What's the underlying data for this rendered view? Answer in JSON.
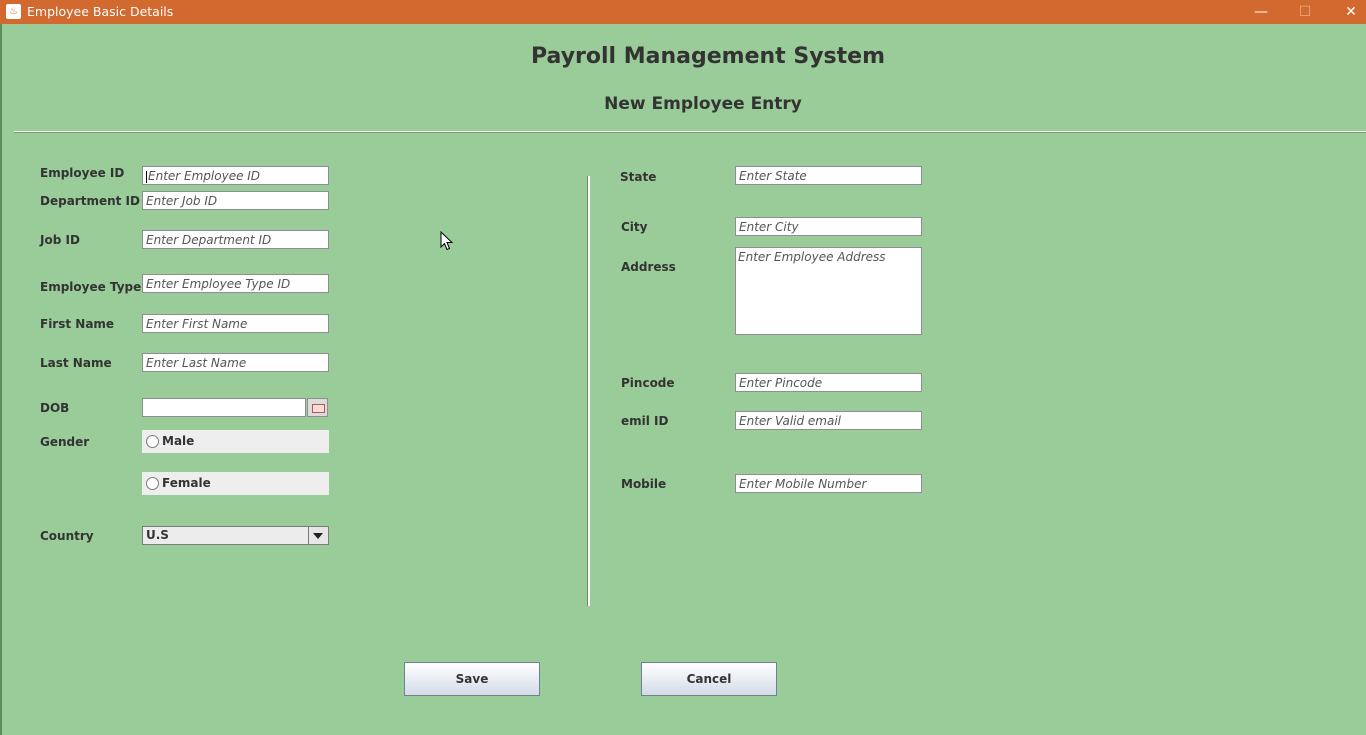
{
  "window": {
    "title": "Employee Basic Details",
    "controls": {
      "minimize": "—",
      "maximize": "☐",
      "close": "✕"
    }
  },
  "header": {
    "title": "Payroll Management System",
    "subtitle": "New Employee Entry"
  },
  "left_form": {
    "employee_id": {
      "label": "Employee ID",
      "placeholder": "Enter Employee ID"
    },
    "department_id": {
      "label": "Department ID",
      "placeholder": "Enter Job ID"
    },
    "job_id": {
      "label": "Job ID",
      "placeholder": "Enter Department ID"
    },
    "employee_type_id": {
      "label": "Employee Type ID",
      "placeholder": "Enter Employee Type ID"
    },
    "first_name": {
      "label": "First Name",
      "placeholder": "Enter First Name"
    },
    "last_name": {
      "label": "Last Name",
      "placeholder": "Enter Last Name"
    },
    "dob": {
      "label": "DOB",
      "value": ""
    },
    "gender": {
      "label": "Gender",
      "options": [
        "Male",
        "Female"
      ]
    },
    "country": {
      "label": "Country",
      "selected": "U.S"
    }
  },
  "right_form": {
    "state": {
      "label": "State",
      "placeholder": "Enter State"
    },
    "city": {
      "label": "City",
      "placeholder": "Enter City"
    },
    "address": {
      "label": "Address",
      "placeholder": "Enter Employee Address"
    },
    "pincode": {
      "label": "Pincode",
      "placeholder": "Enter Pincode"
    },
    "email": {
      "label": "emil ID",
      "placeholder": "Enter Valid email"
    },
    "mobile": {
      "label": "Mobile",
      "placeholder": "Enter Mobile Number"
    }
  },
  "buttons": {
    "save": "Save",
    "cancel": "Cancel"
  },
  "icons": {
    "app": "java-cup-icon",
    "calendar": "calendar-icon",
    "dropdown": "chevron-down-icon",
    "cursor": "mouse-pointer-icon"
  },
  "colors": {
    "titlebar": "#d2692e",
    "background": "#99cc99",
    "button_gradient_end": "#d3dbe8"
  }
}
